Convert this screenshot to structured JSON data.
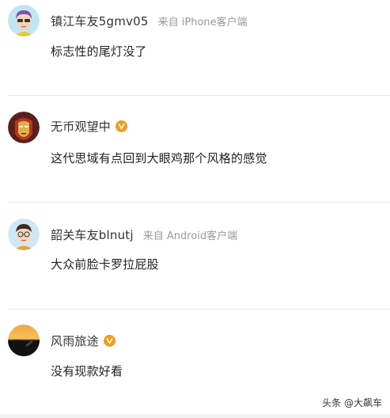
{
  "comments": [
    {
      "username": "镇江车友5gmv05",
      "source": "来自 iPhone客户端",
      "verified": false,
      "avatar": "cartoon-avatar-purple-hair-icon",
      "content": "标志性的尾灯没了"
    },
    {
      "username": "无币观望中",
      "source": "",
      "verified": true,
      "avatar": "iron-man-avatar-icon",
      "content": "这代思域有点回到大眼鸡那个风格的感觉"
    },
    {
      "username": "韶关车友blnutj",
      "source": "来自 Android客户端",
      "verified": false,
      "avatar": "cartoon-avatar-glasses-icon",
      "content": "大众前脸卡罗拉屁股"
    },
    {
      "username": "风雨旅途",
      "source": "",
      "verified": true,
      "avatar": "sunset-landscape-avatar-icon",
      "content": "没有现款好看"
    }
  ],
  "watermark": "头条 @大飙车",
  "colors": {
    "badge": "#f39a1e",
    "divider": "#e8e8e8",
    "source_text": "#999999"
  }
}
